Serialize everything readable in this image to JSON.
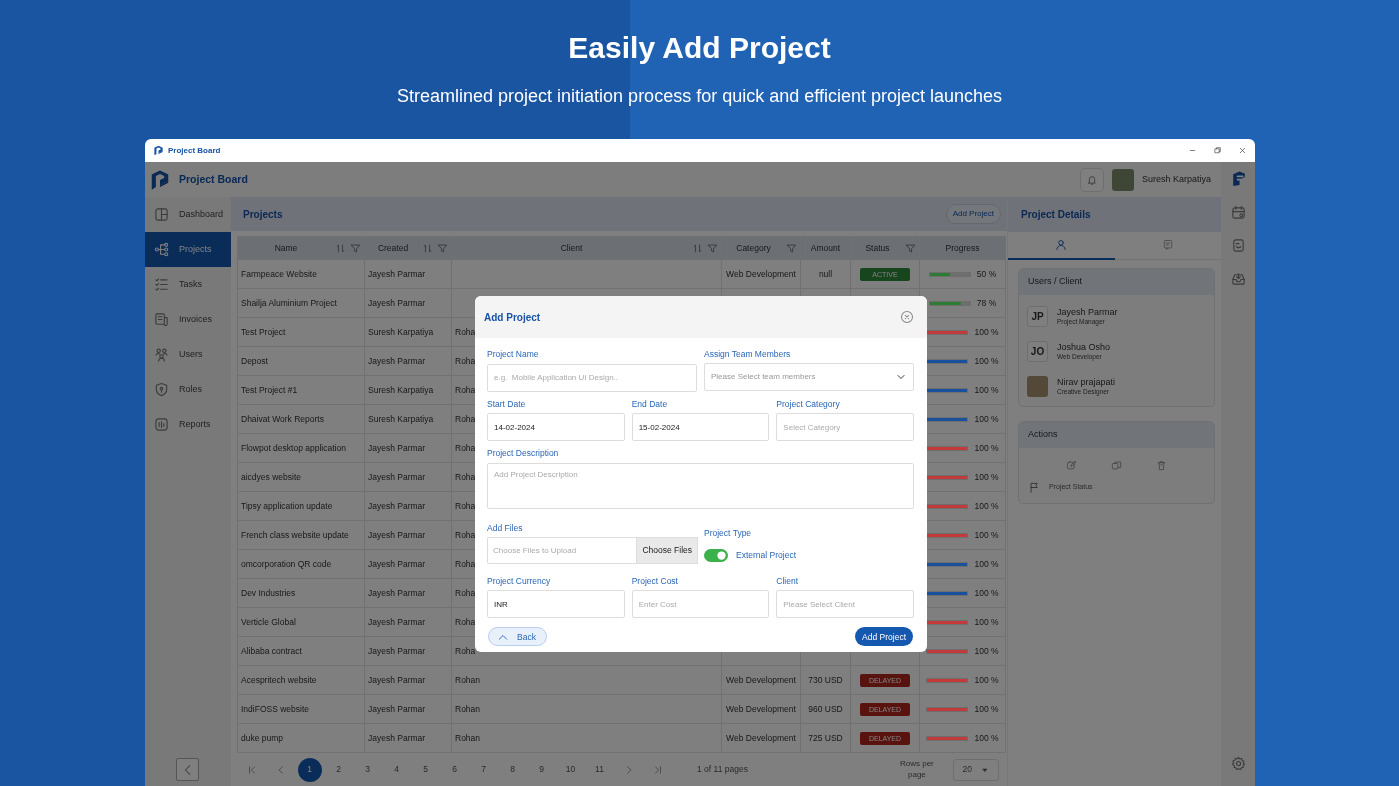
{
  "hero": {
    "title": "Easily Add Project",
    "subtitle": "Streamlined project initiation process for quick and efficient project launches"
  },
  "window": {
    "title": "Project Board"
  },
  "header": {
    "brand": "Project Board",
    "user": "Suresh Karpatiya"
  },
  "sidebar": {
    "items": [
      {
        "label": "Dashboard",
        "selected": false
      },
      {
        "label": "Projects",
        "selected": true
      },
      {
        "label": "Tasks",
        "selected": false
      },
      {
        "label": "Invoices",
        "selected": false
      },
      {
        "label": "Users",
        "selected": false
      },
      {
        "label": "Roles",
        "selected": false
      },
      {
        "label": "Reports",
        "selected": false
      }
    ]
  },
  "projects": {
    "title": "Projects",
    "add_button": "Add Project",
    "columns": [
      {
        "label": "Name",
        "sortable": true,
        "filterable": true
      },
      {
        "label": "Created",
        "sortable": true,
        "filterable": true
      },
      {
        "label": "Client",
        "sortable": true,
        "filterable": true
      },
      {
        "label": "Category",
        "sortable": false,
        "filterable": true
      },
      {
        "label": "Amount",
        "sortable": false,
        "filterable": false
      },
      {
        "label": "Status",
        "sortable": false,
        "filterable": true
      },
      {
        "label": "Progress",
        "sortable": false,
        "filterable": false
      }
    ],
    "rows": [
      {
        "name": "Farmpeace Website",
        "created": "Jayesh Parmar",
        "category": "Web Development",
        "amount": "null",
        "status": {
          "label": "ACTIVE",
          "kind": "active"
        },
        "progress": {
          "level": 0.5,
          "color": "#2a7d32",
          "reading": "50 %"
        }
      },
      {
        "name": "Shailja Aluminium Project",
        "created": "Jayesh Parmar",
        "progress": {
          "level": 0.78,
          "color": "#2a7d32",
          "reading": "78 %"
        }
      },
      {
        "name": "Test Project",
        "created": "Suresh Karpatiya",
        "client": "Roha",
        "progress": {
          "level": 1,
          "color": "#c43a3a",
          "reading": "100 %"
        }
      },
      {
        "name": "Depost",
        "created": "Jayesh Parmar",
        "client": "Roha",
        "progress": {
          "level": 1,
          "color": "#1a4f9c",
          "reading": "100 %"
        }
      },
      {
        "name": "Test Project #1",
        "created": "Suresh Karpatiya",
        "client": "Roha",
        "progress": {
          "level": 1,
          "color": "#1a4f9c",
          "reading": "100 %"
        }
      },
      {
        "name": "Dhaivat Work Reports",
        "created": "Suresh Karpatiya",
        "client": "Roha",
        "progress": {
          "level": 1,
          "color": "#1a4f9c",
          "reading": "100 %"
        }
      },
      {
        "name": "Flowpot desktop application",
        "created": "Jayesh Parmar",
        "client": "Roha",
        "progress": {
          "level": 1,
          "color": "#c43a3a",
          "reading": "100 %"
        }
      },
      {
        "name": "aicdyes website",
        "created": "Jayesh Parmar",
        "client": "Roha",
        "progress": {
          "level": 1,
          "color": "#c43a3a",
          "reading": "100 %"
        }
      },
      {
        "name": "Tipsy application update",
        "created": "Jayesh Parmar",
        "client": "Roha",
        "progress": {
          "level": 1,
          "color": "#c43a3a",
          "reading": "100 %"
        }
      },
      {
        "name": "French class website update",
        "created": "Jayesh Parmar",
        "client": "Roha",
        "progress": {
          "level": 1,
          "color": "#c43a3a",
          "reading": "100 %"
        }
      },
      {
        "name": "omcorporation QR code",
        "created": "Jayesh Parmar",
        "client": "Roha",
        "progress": {
          "level": 1,
          "color": "#1a4f9c",
          "reading": "100 %"
        }
      },
      {
        "name": "Dev Industries",
        "created": "Jayesh Parmar",
        "client": "Roha",
        "progress": {
          "level": 1,
          "color": "#1a4f9c",
          "reading": "100 %"
        }
      },
      {
        "name": "Verticle Global",
        "created": "Jayesh Parmar",
        "client": "Roha",
        "progress": {
          "level": 1,
          "color": "#c43a3a",
          "reading": "100 %"
        }
      },
      {
        "name": "Alibaba contract",
        "created": "Jayesh Parmar",
        "client": "Roha",
        "progress": {
          "level": 1,
          "color": "#c43a3a",
          "reading": "100 %"
        }
      },
      {
        "name": "Acespritech website",
        "created": "Jayesh Parmar",
        "client": "Rohan",
        "category": "Web Development",
        "amount": "730 USD",
        "status": {
          "label": "DELAYED",
          "kind": "delayed"
        },
        "progress": {
          "level": 1,
          "color": "#c43a3a",
          "reading": "100 %"
        }
      },
      {
        "name": "IndiFOSS website",
        "created": "Jayesh Parmar",
        "client": "Rohan",
        "category": "Web Development",
        "amount": "960 USD",
        "status": {
          "label": "DELAYED",
          "kind": "delayed"
        },
        "progress": {
          "level": 1,
          "color": "#c43a3a",
          "reading": "100 %"
        }
      },
      {
        "name": "duke pump",
        "created": "Jayesh Parmar",
        "client": "Rohan",
        "category": "Web Development",
        "amount": "725 USD",
        "status": {
          "label": "DELAYED",
          "kind": "delayed"
        },
        "progress": {
          "level": 1,
          "color": "#c43a3a",
          "reading": "100 %"
        }
      }
    ]
  },
  "pagination": {
    "pages": [
      {
        "label": "1",
        "selected": true
      },
      {
        "label": "2",
        "selected": false
      },
      {
        "label": "3",
        "selected": false
      },
      {
        "label": "4",
        "selected": false
      },
      {
        "label": "5",
        "selected": false
      },
      {
        "label": "6",
        "selected": false
      },
      {
        "label": "7",
        "selected": false
      },
      {
        "label": "8",
        "selected": false
      },
      {
        "label": "9",
        "selected": false
      },
      {
        "label": "10",
        "selected": false
      },
      {
        "label": "11",
        "selected": false
      }
    ],
    "summary": "1 of 11 pages",
    "rows_label": "Rows per page",
    "rows_value": "20"
  },
  "details": {
    "title": "Project Details",
    "tabs": [
      {
        "selected": true
      },
      {
        "selected": false
      }
    ],
    "users_title": "Users / Client",
    "users": [
      {
        "kind": "initials",
        "initials": "JP",
        "name": "Jayesh Parmar",
        "role": "Project Manager"
      },
      {
        "kind": "initials",
        "initials": "JO",
        "name": "Joshua Osho",
        "role": "Web Developer"
      },
      {
        "kind": "photo",
        "name": "Nirav prajapati",
        "role": "Creative Designer"
      }
    ],
    "actions_title": "Actions",
    "status_label": "Project Status"
  },
  "modal": {
    "title": "Add Project",
    "rows": [
      [
        {
          "kind": "text",
          "label": "Project Name",
          "placeholder": "e.g.  Mobile Application UI Design.."
        },
        {
          "kind": "select",
          "label": "Assign Team Members",
          "placeholder": "Please Select team members"
        }
      ],
      [
        {
          "kind": "date",
          "label": "Start Date",
          "value": "14-02-2024"
        },
        {
          "kind": "date",
          "label": "End Date",
          "value": "15-02-2024"
        },
        {
          "kind": "text",
          "label": "Project Category",
          "placeholder": "Select Category"
        }
      ],
      [
        {
          "kind": "textarea",
          "label": "Project Description",
          "placeholder": "Add Project Description"
        }
      ],
      [
        {
          "kind": "file",
          "label": "Add Files",
          "placeholder": "Choose Files to Upload",
          "button": "Choose Files"
        },
        {
          "kind": "toggle",
          "label": "Project Type",
          "option": "External Project",
          "on": true
        }
      ],
      [
        {
          "kind": "text",
          "label": "Project Currency",
          "value": "INR"
        },
        {
          "kind": "text",
          "label": "Project Cost",
          "placeholder": "Enter Cost"
        },
        {
          "kind": "text",
          "label": "Client",
          "placeholder": "Please Select Client"
        }
      ]
    ],
    "back_button": "Back",
    "submit_button": "Add Project"
  }
}
